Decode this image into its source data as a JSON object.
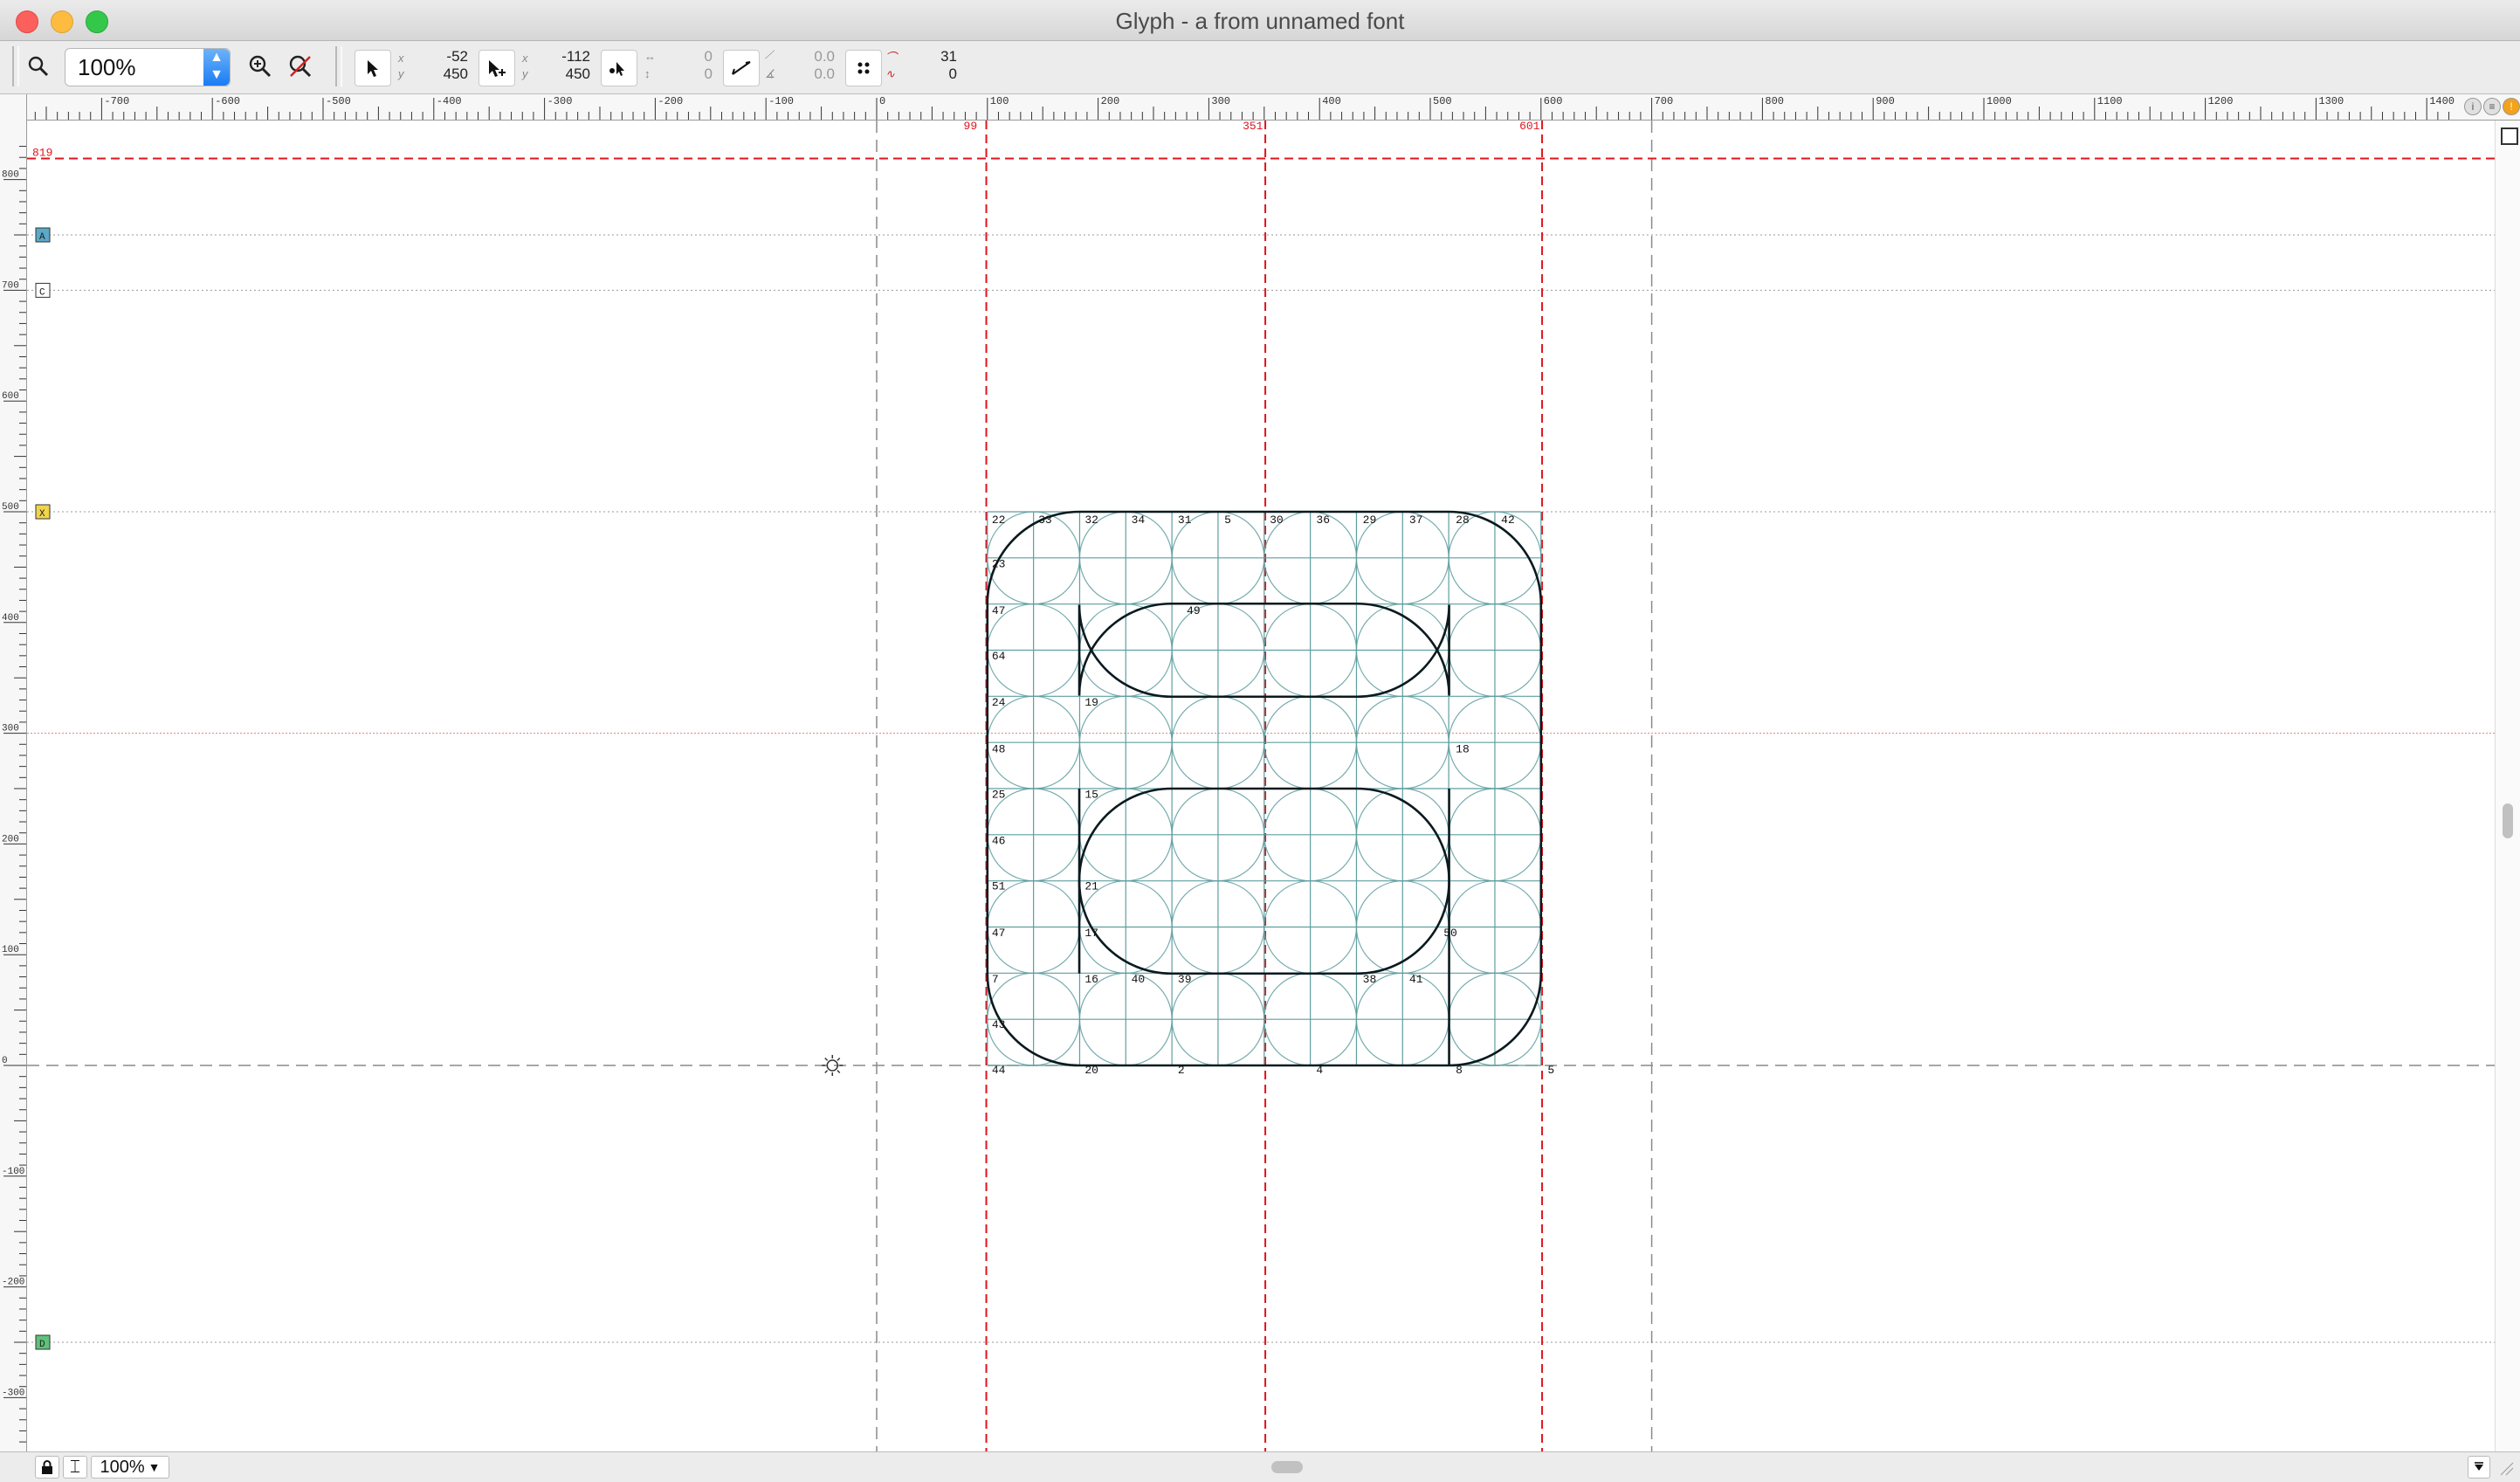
{
  "window": {
    "title": "Glyph - a from unnamed font"
  },
  "toolbar": {
    "zoom_value": "100%",
    "pointer1": {
      "x": "-52",
      "y": "450"
    },
    "pointer2": {
      "x": "-112",
      "y": "450"
    },
    "delta": {
      "x": "0",
      "y": "0"
    },
    "angle": {
      "a": "0.0",
      "b": "0.0"
    },
    "count": {
      "a": "31",
      "b": "0"
    },
    "labels": {
      "x": "x",
      "y": "y"
    }
  },
  "statusbar": {
    "zoom": "100%"
  },
  "ruler": {
    "horizontal_ticks": [
      "-700",
      "-600",
      "-500",
      "-400",
      "-300",
      "-200",
      "-100",
      "0",
      "100",
      "200",
      "300",
      "400",
      "500",
      "600",
      "700",
      "800",
      "900",
      "1000",
      "1100",
      "1200",
      "1300",
      "1400"
    ],
    "vertical_ticks": [
      "800",
      "700",
      "600",
      "500",
      "400",
      "300",
      "200",
      "100",
      "0",
      "-100",
      "-200",
      "-300"
    ],
    "guide_labels_top": [
      "99",
      "351",
      "601"
    ],
    "guide_label_left": "819"
  },
  "metrics_markers": [
    "A",
    "C",
    "X",
    "D"
  ],
  "point_labels": [
    "22",
    "33",
    "32",
    "34",
    "31",
    "5",
    "30",
    "36",
    "29",
    "37",
    "28",
    "42",
    "23",
    "47",
    "49",
    "64",
    "24",
    "19",
    "18",
    "48",
    "25",
    "15",
    "46",
    "21",
    "51",
    "47",
    "17",
    "50",
    "7",
    "16",
    "40",
    "39",
    "38",
    "41",
    "43",
    "44",
    "20",
    "2",
    "4",
    "8",
    "5"
  ],
  "colors": {
    "guide_red": "#e0141c",
    "grid_teal": "#5e9ea0",
    "outline": "#0a1a1f",
    "metric_gray": "#999999",
    "toolbar_blue": "#1a7cf2"
  }
}
